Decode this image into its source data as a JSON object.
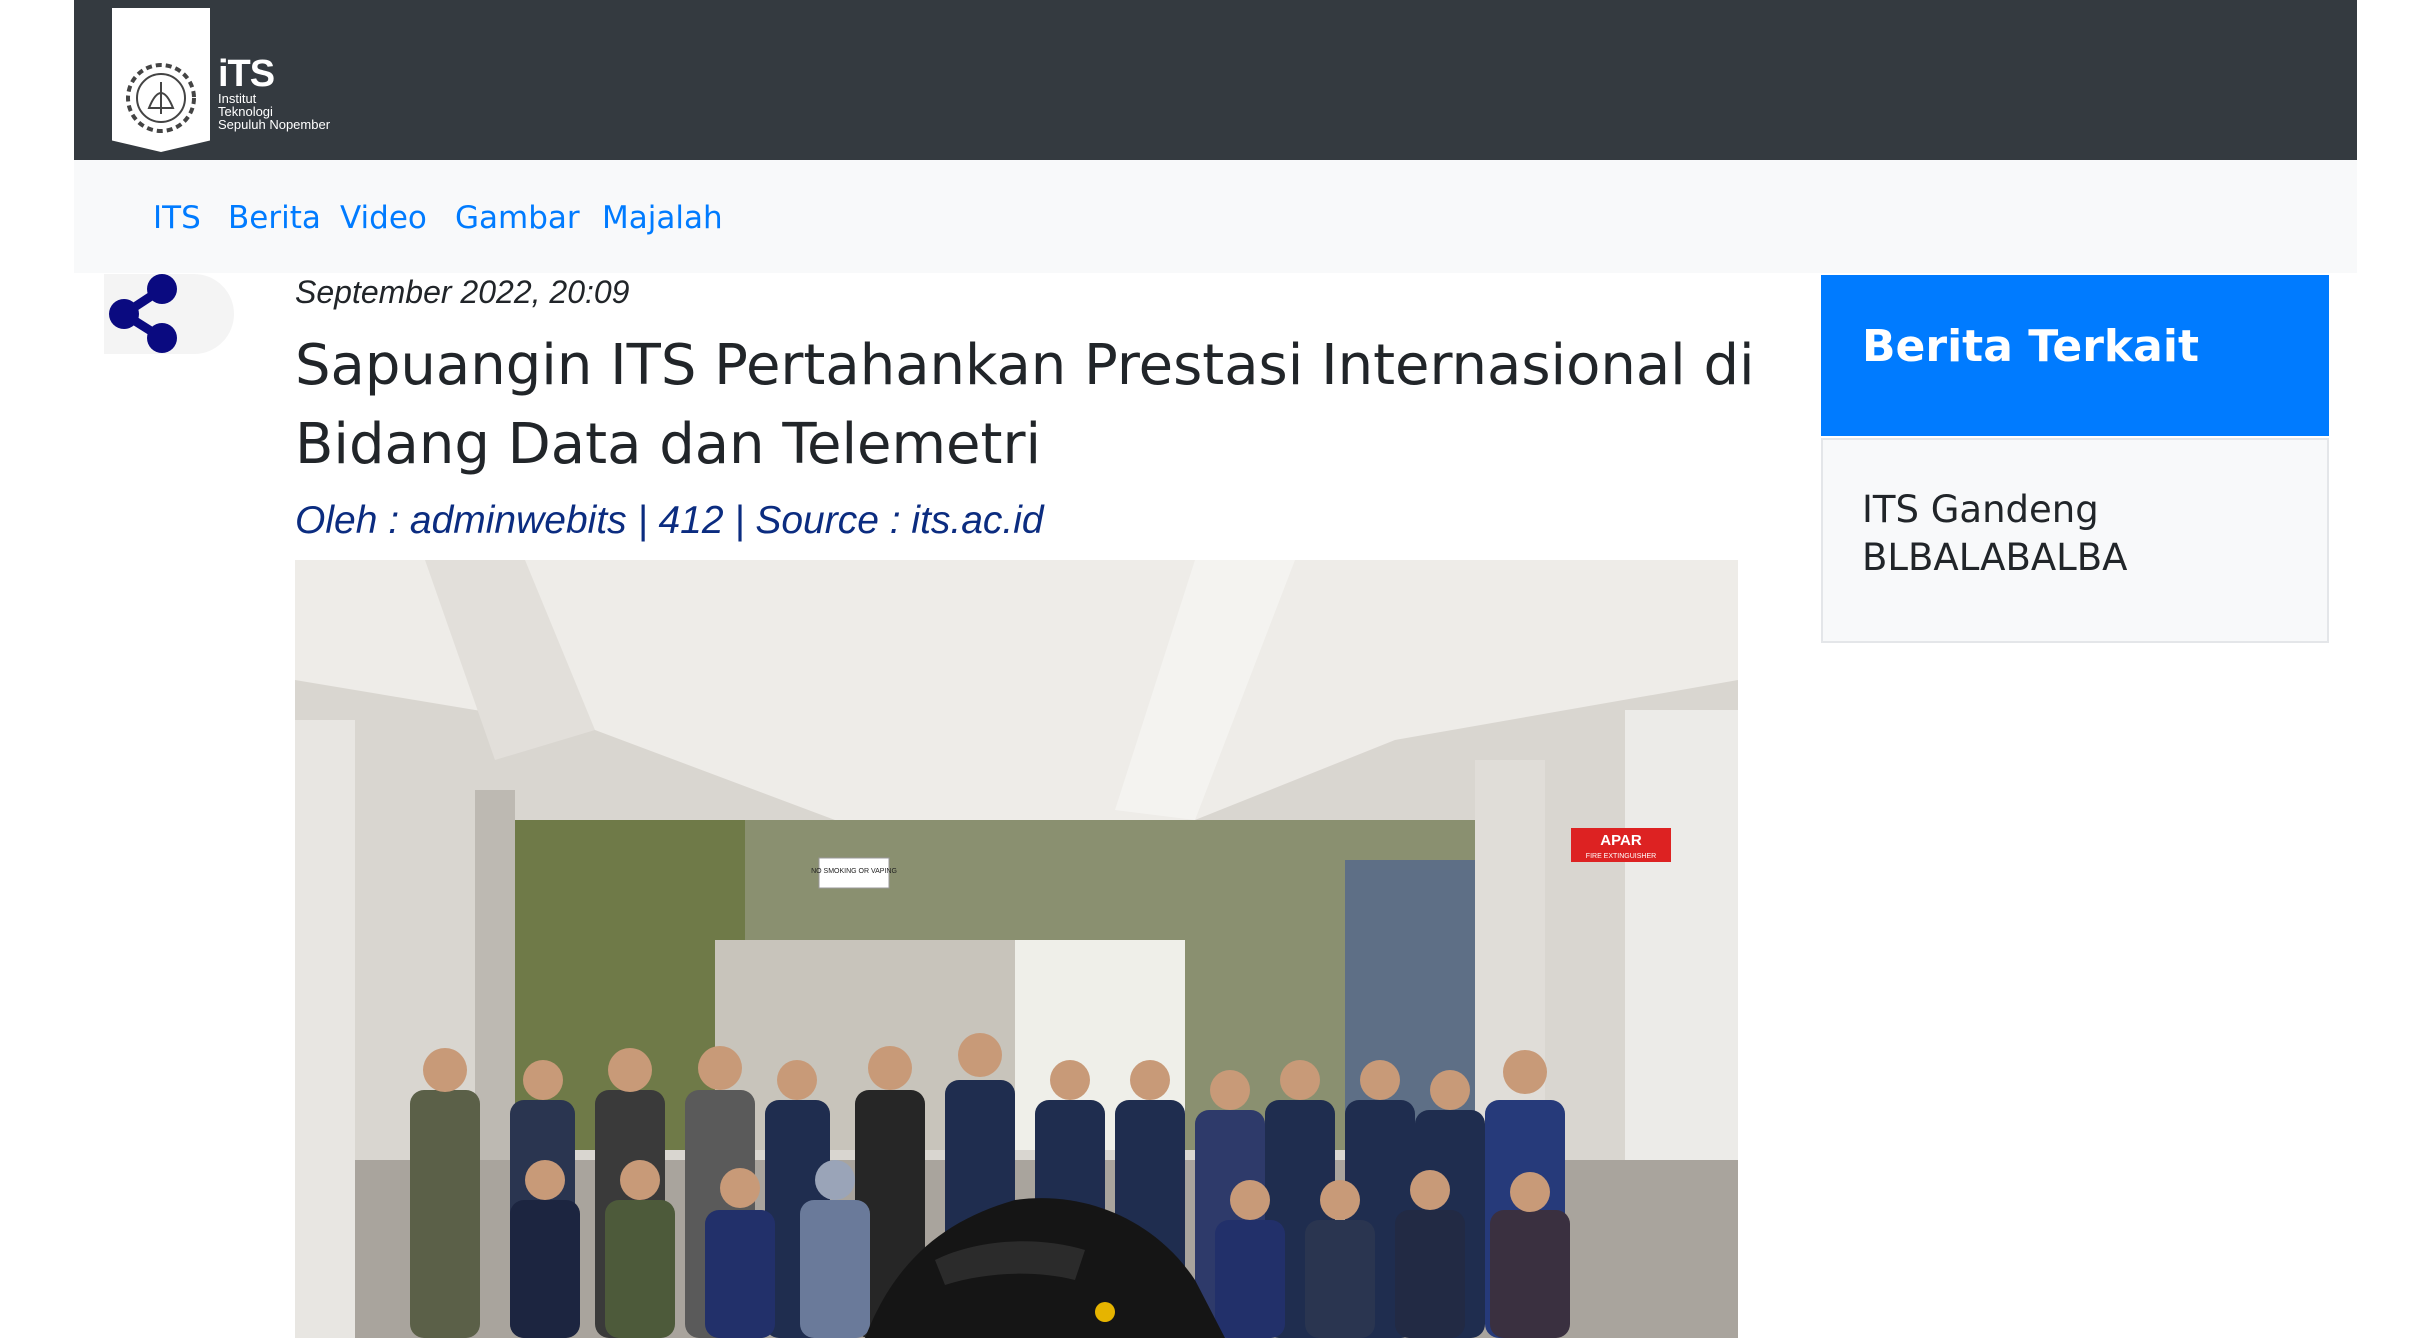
{
  "header": {
    "logo": {
      "wordmark": "iTS",
      "lines": [
        "Institut",
        "Teknologi",
        "Sepuluh Nopember"
      ]
    }
  },
  "nav": {
    "items": [
      "ITS",
      "Berita",
      "Video",
      "Gambar",
      "Majalah"
    ]
  },
  "article": {
    "date": "September 2022, 20:09",
    "title": "Sapuangin ITS Pertahankan Prestasi Internasional di Bidang Data dan Telemetri",
    "byline": "Oleh : adminwebits | 412 | Source : its.ac.id",
    "photo_signs": {
      "no_smoking": "NO SMOKING OR VAPING",
      "apar": "APAR",
      "apar_sub": "FIRE EXTINGUISHER"
    }
  },
  "sidebar": {
    "title": "Berita Terkait",
    "items": [
      "ITS Gandeng BLBALABALBA"
    ]
  },
  "icons": {
    "share": "share-icon",
    "logo": "its-logo-icon"
  },
  "colors": {
    "topbar": "#343a40",
    "link": "#007bff",
    "byline": "#0b2c80",
    "share_icon": "#0a0a80",
    "sidebar_header": "#007bff"
  }
}
